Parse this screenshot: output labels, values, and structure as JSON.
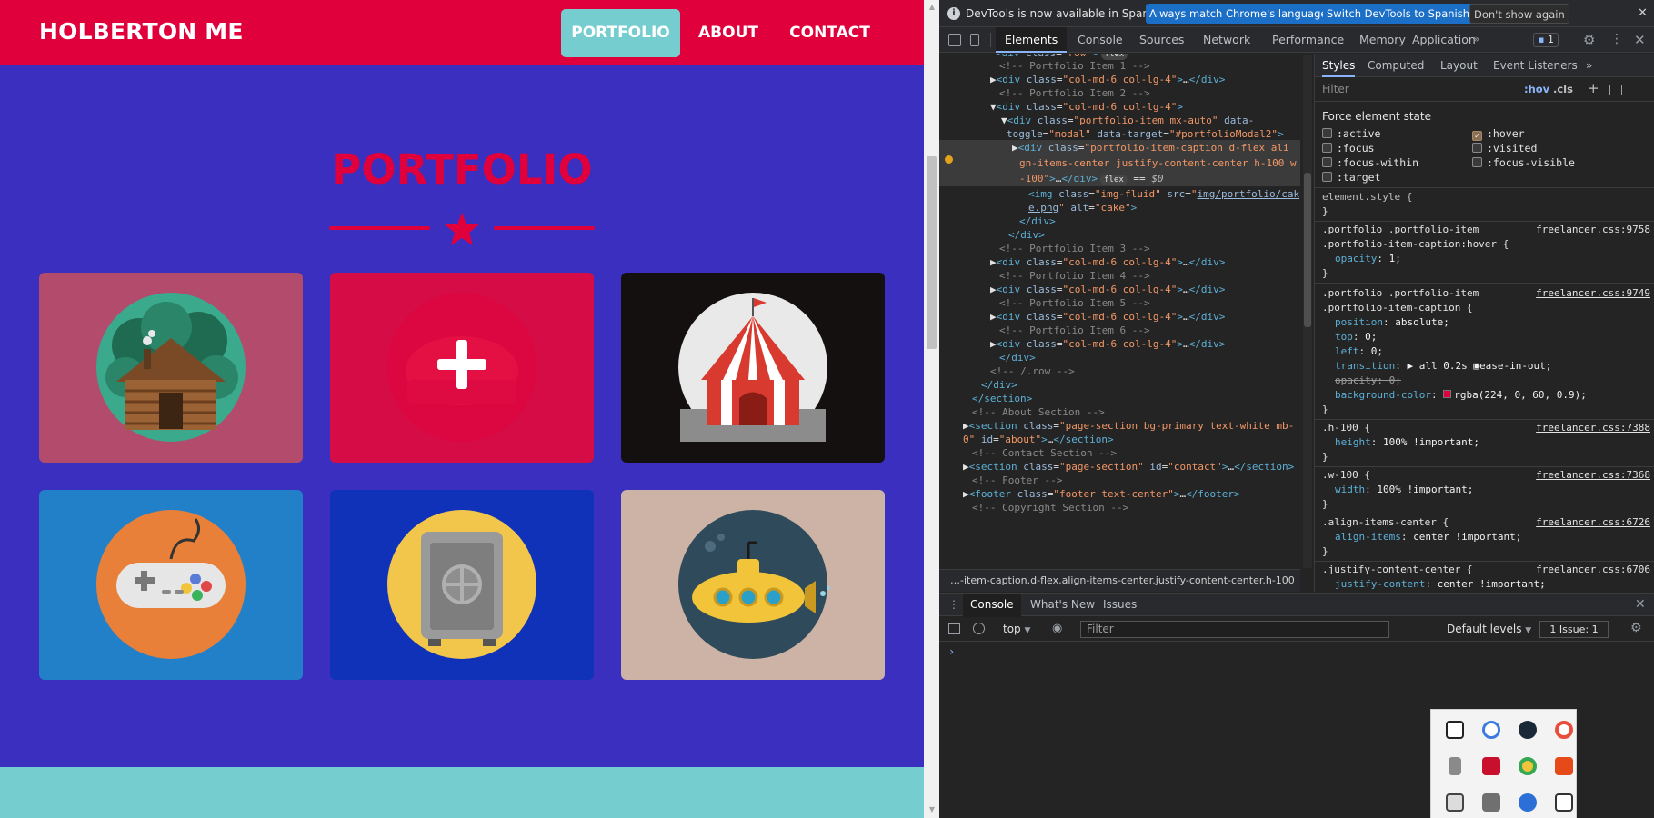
{
  "site": {
    "brand": "HOLBERTON ME",
    "nav": {
      "portfolio": "PORTFOLIO",
      "about": "ABOUT",
      "contact": "CONTACT"
    },
    "section_title": "PORTFOLIO",
    "items": [
      {
        "name": "cabin",
        "alt": "cabin"
      },
      {
        "name": "cake",
        "alt": "cake"
      },
      {
        "name": "circus",
        "alt": "circus"
      },
      {
        "name": "game",
        "alt": "game"
      },
      {
        "name": "safe",
        "alt": "safe"
      },
      {
        "name": "submarine",
        "alt": "submarine"
      }
    ],
    "colors": {
      "primary": "#e0003c",
      "background": "#3b2fbf",
      "accent": "#75cdd0"
    }
  },
  "devtools": {
    "infobar": {
      "text": "DevTools is now available in Spanish!",
      "match_button": "Always match Chrome's language",
      "switch_button": "Switch DevTools to Spanish",
      "dismiss_button": "Don't show again"
    },
    "tabs": [
      "Elements",
      "Console",
      "Sources",
      "Network",
      "Performance",
      "Memory",
      "Application"
    ],
    "issues_count": "1",
    "elements_breadcrumb": "…-item-caption.d-flex.align-items-center.justify-content-center.h-100",
    "tree": [
      {
        "text": "<div class=\"row\"> flex"
      },
      {
        "text": "<!-- Portfolio Item 1 -->"
      },
      {
        "text": "▶<div class=\"col-md-6 col-lg-4\">…</div>"
      },
      {
        "text": "<!-- Portfolio Item 2 -->"
      },
      {
        "text": "▼<div class=\"col-md-6 col-lg-4\">"
      },
      {
        "text": "▼<div class=\"portfolio-item mx-auto\" data-"
      },
      {
        "text": "toggle=\"modal\" data-target=\"#portfolioModal2\">"
      },
      {
        "text": "▶<div class=\"portfolio-item-caption d-flex ali"
      },
      {
        "text": "gn-items-center justify-content-center h-100 w"
      },
      {
        "text": "-100\">…</div> flex == $0"
      },
      {
        "text": "<img class=\"img-fluid\" src=\"img/portfolio/cak"
      },
      {
        "text": "e.png\" alt=\"cake\">"
      },
      {
        "text": "</div>"
      },
      {
        "text": "</div>"
      },
      {
        "text": "<!-- Portfolio Item 3 -->"
      },
      {
        "text": "▶<div class=\"col-md-6 col-lg-4\">…</div>"
      },
      {
        "text": "<!-- Portfolio Item 4 -->"
      },
      {
        "text": "▶<div class=\"col-md-6 col-lg-4\">…</div>"
      },
      {
        "text": "<!-- Portfolio Item 5 -->"
      },
      {
        "text": "▶<div class=\"col-md-6 col-lg-4\">…</div>"
      },
      {
        "text": "<!-- Portfolio Item 6 -->"
      },
      {
        "text": "▶<div class=\"col-md-6 col-lg-4\">…</div>"
      },
      {
        "text": "</div>"
      },
      {
        "text": "<!-- /.row -->"
      },
      {
        "text": "</div>"
      },
      {
        "text": "</section>"
      },
      {
        "text": "<!-- About Section -->"
      },
      {
        "text": "▶<section class=\"page-section bg-primary text-white mb-"
      },
      {
        "text": "0\" id=\"about\">…</section>"
      },
      {
        "text": "<!-- Contact Section -->"
      },
      {
        "text": "▶<section class=\"page-section\" id=\"contact\">…</section>"
      },
      {
        "text": "<!-- Footer -->"
      },
      {
        "text": "▶<footer class=\"footer text-center\">…</footer>"
      },
      {
        "text": "<!-- Copyright Section -->"
      }
    ],
    "styles": {
      "tabs": [
        "Styles",
        "Computed",
        "Layout",
        "Event Listeners"
      ],
      "filter_placeholder": "Filter",
      "hov": ":hov",
      "cls": ".cls",
      "force_state_title": "Force element state",
      "states_left": [
        ":active",
        ":focus",
        ":focus-within",
        ":target"
      ],
      "states_right": [
        ":hover",
        ":visited",
        ":focus-visible"
      ],
      "checked_state": ":hover",
      "rules": [
        {
          "selector": "element.style {",
          "source": "",
          "props": [],
          "close": "}"
        },
        {
          "selector": ".portfolio .portfolio-item",
          "selector2": ".portfolio-item-caption:hover {",
          "source": "freelancer.css:9758",
          "props": [
            {
              "p": "opacity",
              "v": "1;"
            }
          ],
          "close": "}"
        },
        {
          "selector": ".portfolio .portfolio-item",
          "selector2": ".portfolio-item-caption {",
          "source": "freelancer.css:9749",
          "props": [
            {
              "p": "position",
              "v": "absolute;"
            },
            {
              "p": "top",
              "v": "0;"
            },
            {
              "p": "left",
              "v": "0;"
            },
            {
              "p": "transition",
              "v": "▶ all 0.2s ▣ease-in-out;"
            },
            {
              "p": "opacity",
              "v": "0;",
              "struck": true
            },
            {
              "p": "background-color",
              "v": "rgba(224, 0, 60, 0.9);"
            }
          ],
          "close": "}"
        },
        {
          "selector": ".h-100 {",
          "source": "freelancer.css:7388",
          "props": [
            {
              "p": "height",
              "v": "100% !important;"
            }
          ],
          "close": "}"
        },
        {
          "selector": ".w-100 {",
          "source": "freelancer.css:7368",
          "props": [
            {
              "p": "width",
              "v": "100% !important;"
            }
          ],
          "close": "}"
        },
        {
          "selector": ".align-items-center {",
          "source": "freelancer.css:6726",
          "props": [
            {
              "p": "align-items",
              "v": "center !important;"
            }
          ],
          "close": "}"
        },
        {
          "selector": ".justify-content-center {",
          "source": "freelancer.css:6706",
          "props": [
            {
              "p": "justify-content",
              "v": "center !important;"
            }
          ],
          "close": "}"
        }
      ]
    },
    "drawer": {
      "tabs": [
        "Console",
        "What's New",
        "Issues"
      ],
      "context": "top",
      "filter_placeholder": "Filter",
      "levels": "Default levels",
      "issues": "1 Issue: 1",
      "prompt": "›"
    }
  }
}
